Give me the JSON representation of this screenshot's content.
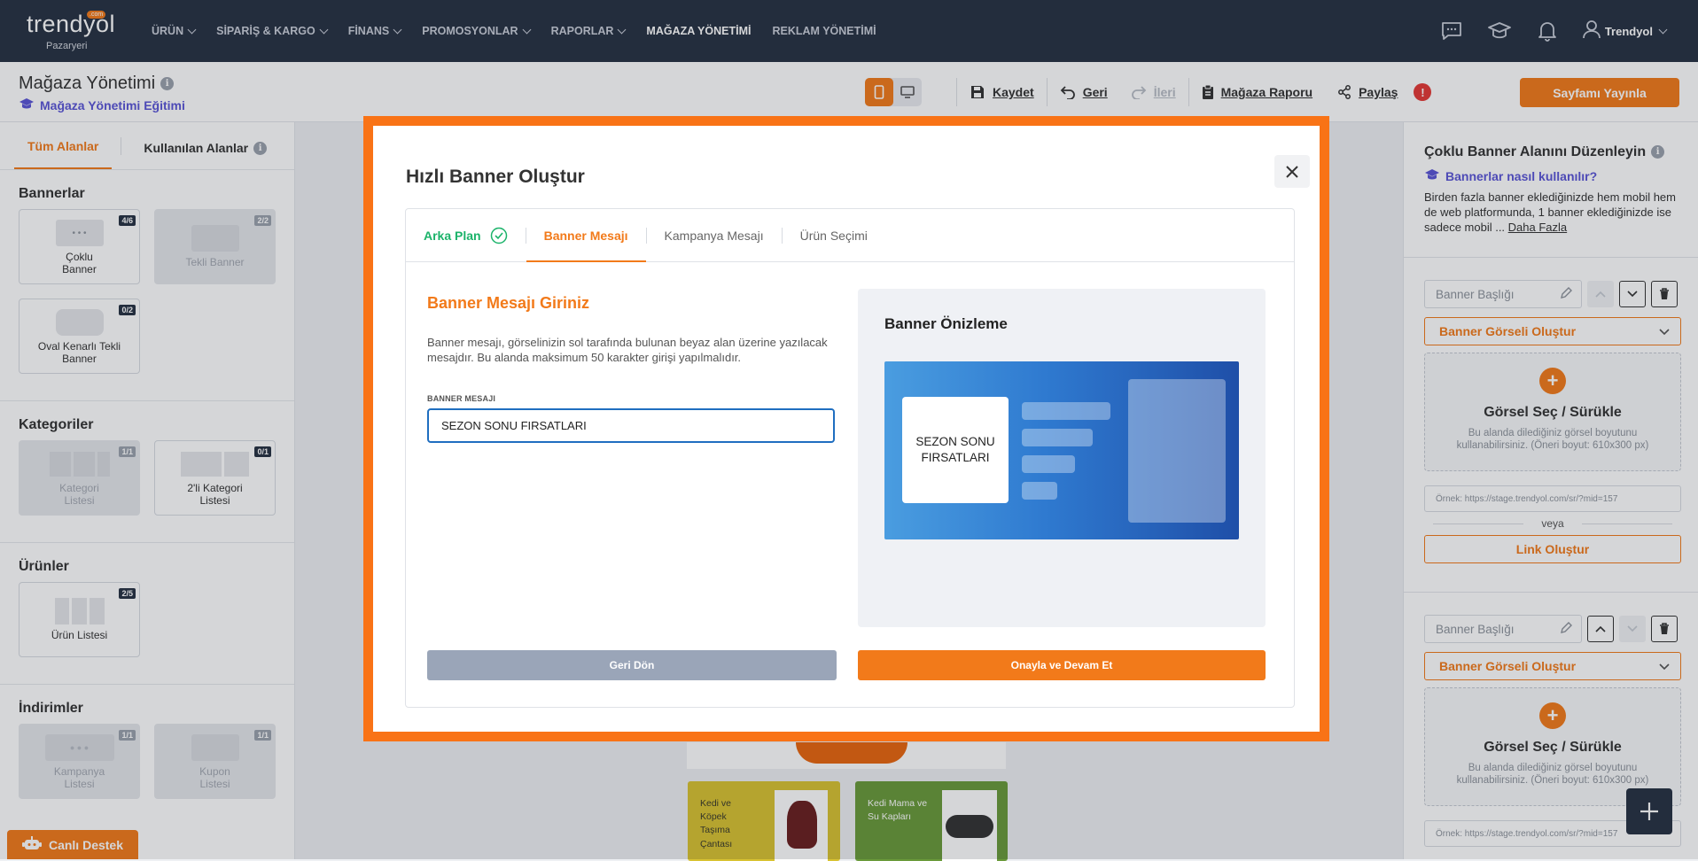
{
  "topnav": {
    "logo": {
      "brand": "trendyol",
      "com": ".com",
      "sub": "Pazaryeri"
    },
    "items": [
      {
        "label": "ÜRÜN",
        "has_dropdown": true
      },
      {
        "label": "SİPARİŞ & KARGO",
        "has_dropdown": true
      },
      {
        "label": "FİNANS",
        "has_dropdown": true
      },
      {
        "label": "PROMOSYONLAR",
        "has_dropdown": true
      },
      {
        "label": "RAPORLAR",
        "has_dropdown": true
      },
      {
        "label": "MAĞAZA YÖNETİMİ",
        "active": true
      },
      {
        "label": "REKLAM YÖNETİMİ"
      }
    ],
    "user_name": "Trendyol"
  },
  "subheader": {
    "title": "Mağaza Yönetimi",
    "edu_link": "Mağaza Yönetimi Eğitimi",
    "save": "Kaydet",
    "undo": "Geri",
    "redo": "İleri",
    "report": "Mağaza Raporu",
    "share": "Paylaş",
    "alert": "!",
    "publish": "Sayfamı Yayınla"
  },
  "left": {
    "tabs": [
      "Tüm Alanlar",
      "Kullanılan Alanlar"
    ],
    "sections": [
      {
        "title": "Bannerlar",
        "cards": [
          {
            "label": "Çoklu Banner",
            "badge": "4/6",
            "disabled": false
          },
          {
            "label": "Tekli Banner",
            "badge": "2/2",
            "disabled": true
          },
          {
            "label": "Oval Kenarlı Tekli Banner",
            "badge": "0/2",
            "disabled": false
          }
        ]
      },
      {
        "title": "Kategoriler",
        "cards": [
          {
            "label": "Kategori Listesi",
            "badge": "1/1",
            "disabled": true
          },
          {
            "label": "2'li Kategori Listesi",
            "badge": "0/1",
            "disabled": false
          }
        ]
      },
      {
        "title": "Ürünler",
        "cards": [
          {
            "label": "Ürün Listesi",
            "badge": "2/5",
            "disabled": false
          }
        ]
      },
      {
        "title": "İndirimler",
        "cards": [
          {
            "label": "Kampanya Listesi",
            "badge": "1/1",
            "disabled": true
          },
          {
            "label": "Kupon Listesi",
            "badge": "1/1",
            "disabled": true
          }
        ]
      }
    ],
    "support": "Canlı Destek"
  },
  "canvas": {
    "products": [
      {
        "label": "Kedi ve Köpek Taşıma Çantası",
        "color": "#d8c231"
      },
      {
        "label": "Kedi Mama ve Su Kapları",
        "color": "#6a9a3a"
      }
    ]
  },
  "right": {
    "title": "Çoklu Banner Alanını Düzenleyin",
    "howto": "Bannerlar nasıl kullanılır?",
    "desc": "Birden fazla banner eklediğinizde hem mobil hem de web platformunda, 1 banner eklediğinizde ise sadece mobil ...",
    "more": "Daha Fazla",
    "blocks": [
      {
        "title_placeholder": "Banner Başlığı",
        "dropdown": "Banner Görseli Oluştur",
        "drop_title": "Görsel Seç / Sürükle",
        "drop_desc": "Bu alanda dilediğiniz görsel boyutunu kullanabilirsiniz. (Öneri boyut: 610x300 px)",
        "url_placeholder": "Örnek: https://stage.trendyol.com/sr/?mid=157",
        "or": "veya",
        "link_btn": "Link Oluştur"
      },
      {
        "title_placeholder": "Banner Başlığı",
        "dropdown": "Banner Görseli Oluştur",
        "drop_title": "Görsel Seç / Sürükle",
        "drop_desc": "Bu alanda dilediğiniz görsel boyutunu kullanabilirsiniz. (Öneri boyut: 610x300 px)",
        "url_placeholder": "Örnek: https://stage.trendyol.com/sr/?mid=157"
      }
    ]
  },
  "modal": {
    "title": "Hızlı Banner Oluştur",
    "steps": [
      {
        "label": "Arka Plan",
        "state": "done"
      },
      {
        "label": "Banner Mesajı",
        "state": "active"
      },
      {
        "label": "Kampanya Mesajı",
        "state": "pending"
      },
      {
        "label": "Ürün Seçimi",
        "state": "pending"
      }
    ],
    "heading": "Banner Mesajı Giriniz",
    "description": "Banner mesajı, görselinizin sol tarafında bulunan beyaz alan üzerine yazılacak mesajdır. Bu alanda maksimum 50 karakter girişi yapılmalıdır.",
    "field_label": "BANNER MESAJI",
    "field_value": "SEZON SONU FIRSATLARI",
    "preview_title": "Banner Önizleme",
    "preview_message": "SEZON SONU FIRSATLARI",
    "back": "Geri Dön",
    "confirm": "Onayla ve Devam Et"
  },
  "colors": {
    "accent": "#f27a1a",
    "nav_bg": "#273142",
    "success": "#1bb36a",
    "link_purple": "#5a55d6",
    "modal_border": "#f97316"
  }
}
